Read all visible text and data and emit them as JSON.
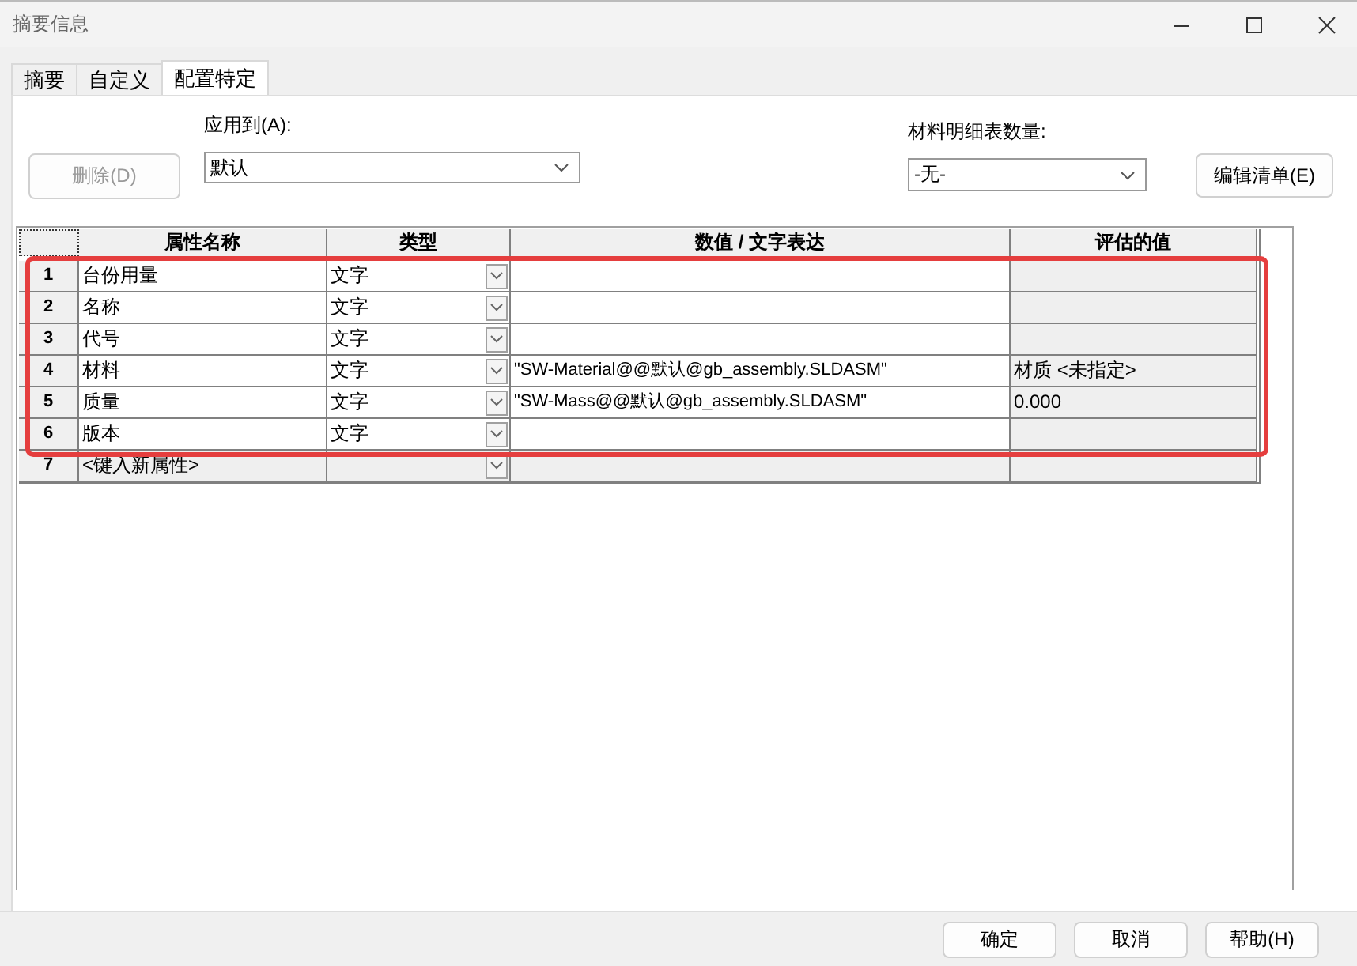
{
  "window": {
    "title": "摘要信息"
  },
  "tabs": [
    {
      "label": "摘要",
      "selected": false
    },
    {
      "label": "自定义",
      "selected": false
    },
    {
      "label": "配置特定",
      "selected": true
    }
  ],
  "apply_to": {
    "label": "应用到(A):",
    "value": "默认"
  },
  "bom_quantity": {
    "label": "材料明细表数量:",
    "value": "-无-"
  },
  "delete_button": {
    "label": "删除(D)",
    "disabled": true
  },
  "edit_list_button": {
    "label": "编辑清单(E)",
    "disabled": false
  },
  "table": {
    "columns": [
      "属性名称",
      "类型",
      "数值 / 文字表达",
      "评估的值"
    ],
    "rows": [
      {
        "number": "1",
        "name": "台份用量",
        "type": "文字",
        "value": "",
        "evaluated": "",
        "kind": "property",
        "highlighted": true
      },
      {
        "number": "2",
        "name": "名称",
        "type": "文字",
        "value": "",
        "evaluated": "",
        "kind": "property",
        "highlighted": true
      },
      {
        "number": "3",
        "name": "代号",
        "type": "文字",
        "value": "",
        "evaluated": "",
        "kind": "property",
        "highlighted": true
      },
      {
        "number": "4",
        "name": "材料",
        "type": "文字",
        "value": "\"SW-Material@@默认@gb_assembly.SLDASM\"",
        "evaluated": "材质 <未指定>",
        "kind": "property",
        "highlighted": true
      },
      {
        "number": "5",
        "name": "质量",
        "type": "文字",
        "value": "\"SW-Mass@@默认@gb_assembly.SLDASM\"",
        "evaluated": "0.000",
        "kind": "property",
        "highlighted": true
      },
      {
        "number": "6",
        "name": "版本",
        "type": "文字",
        "value": "",
        "evaluated": "",
        "kind": "property",
        "highlighted": true
      },
      {
        "number": "7",
        "name": "<键入新属性>",
        "type": "",
        "value": "",
        "evaluated": "",
        "kind": "new",
        "highlighted": false
      }
    ]
  },
  "dialog_buttons": [
    {
      "label": "确定"
    },
    {
      "label": "取消"
    },
    {
      "label": "帮助(H)"
    }
  ]
}
